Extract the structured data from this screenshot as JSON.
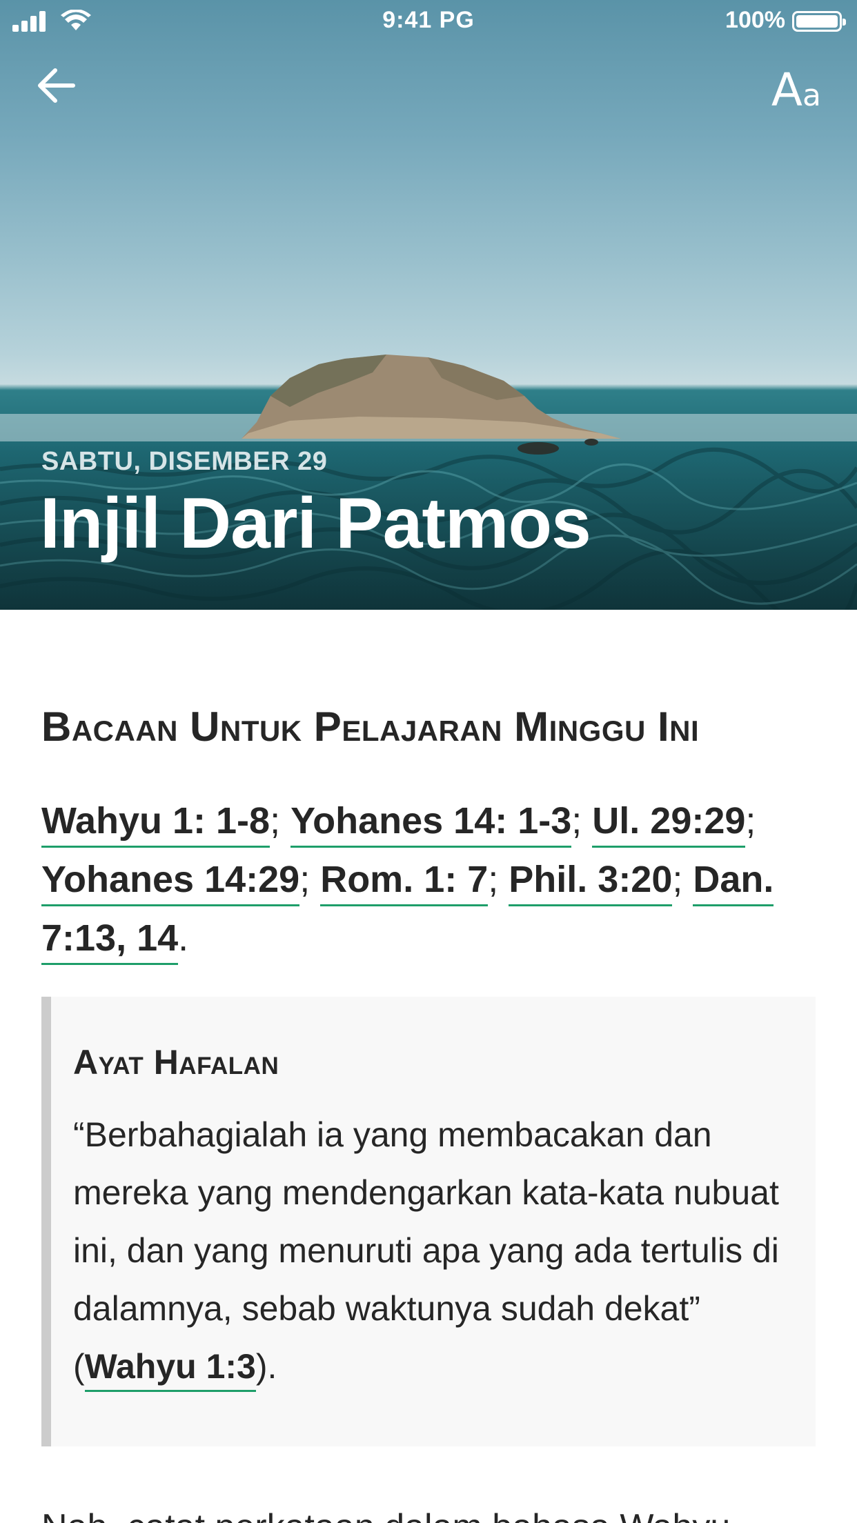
{
  "status_bar": {
    "time": "9:41 PG",
    "battery": "100%",
    "icons": [
      "cellular-signal-icon",
      "wifi-icon",
      "battery-icon"
    ]
  },
  "header": {
    "back_icon": "arrow-left-icon",
    "font_size_icon": "font-size-icon",
    "font_button_big": "A",
    "font_button_small": "a",
    "date": "SABTU, DISEMBER 29",
    "title": "Injil Dari Patmos"
  },
  "readings": {
    "heading": "Bacaan Untuk Pelajaran Minggu Ini",
    "refs": [
      "Wahyu 1: 1-8",
      "Yohanes 14: 1-3",
      "Ul. 29:29",
      "Yohanes 14:29",
      "Rom. 1: 7",
      "Phil. 3:20",
      "Dan. 7:13, 14"
    ]
  },
  "memory_verse": {
    "heading": "Ayat Hafalan",
    "text": "“Berbahagialah ia yang membacakan dan mereka yang mendengarkan kata-kata nubuat ini, dan yang menuruti apa yang ada tertulis di dalamnya, sebab waktunya sudah dekat” (",
    "ref": "Wahyu 1:3",
    "suffix": ")."
  },
  "body": {
    "next_line": "Nah, catat perkataan dalam bahasa Wahyu"
  },
  "colors": {
    "link_underline": "#1e9e6a",
    "blockquote_border": "#cccccc",
    "blockquote_bg": "#f8f8f8",
    "text": "#262626"
  }
}
